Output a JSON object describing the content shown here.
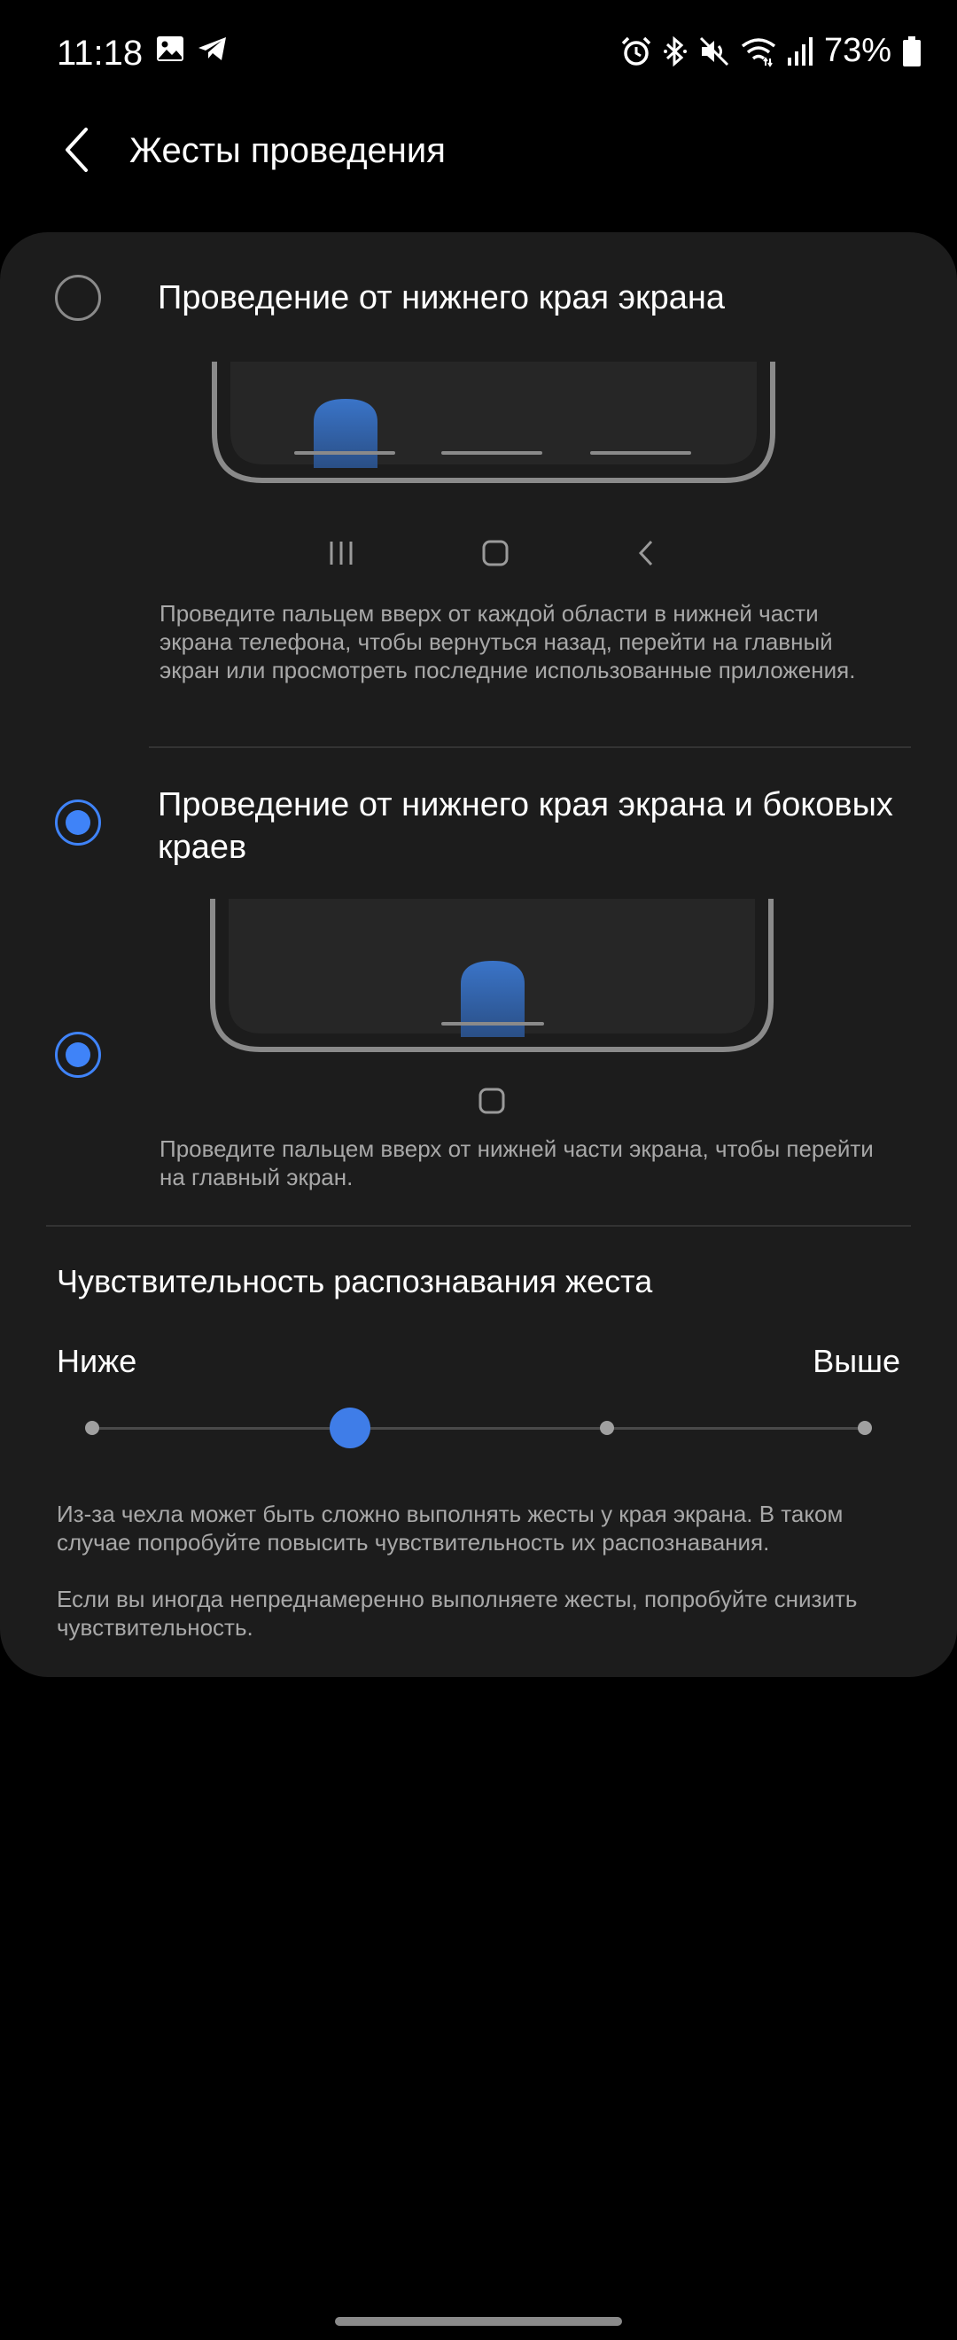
{
  "status_bar": {
    "time": "11:18",
    "battery_percent": "73%",
    "left_icons": [
      "gallery-icon",
      "telegram-icon"
    ],
    "right_icons": [
      "alarm-icon",
      "bluetooth-icon",
      "mute-icon",
      "wifi-icon",
      "signal-icon",
      "battery-icon"
    ]
  },
  "header": {
    "title": "Жесты проведения",
    "back_icon": "chevron-left-icon"
  },
  "options": [
    {
      "title": "Проведение от нижнего края экрана",
      "selected": false,
      "description": "Проведите пальцем вверх от каждой области в нижней части экрана телефона, чтобы вернуться назад, перейти на главный экран или просмотреть последние использованные приложения.",
      "nav_icons": [
        "recents-icon",
        "home-icon",
        "back-icon"
      ]
    },
    {
      "title": "Проведение от нижнего края экрана и боковых краев",
      "selected": true,
      "description": "Проведите пальцем вверх от нижней части экрана, чтобы перейти на главный экран.",
      "nav_icons": [
        "home-icon"
      ]
    }
  ],
  "sensitivity": {
    "title": "Чувствительность распознавания жеста",
    "label_low": "Ниже",
    "label_high": "Выше",
    "steps": 4,
    "value_index": 1
  },
  "notes": [
    "Из-за чехла может быть сложно выполнять жесты у края экрана. В таком случае попробуйте повысить чувствительность их распознавания.",
    "Если вы иногда непреднамеренно выполняете жесты, попробуйте снизить чувствительность."
  ],
  "colors": {
    "accent": "#3f83f8",
    "card_background": "#1c1c1c",
    "secondary_text": "#a8a8a8"
  }
}
